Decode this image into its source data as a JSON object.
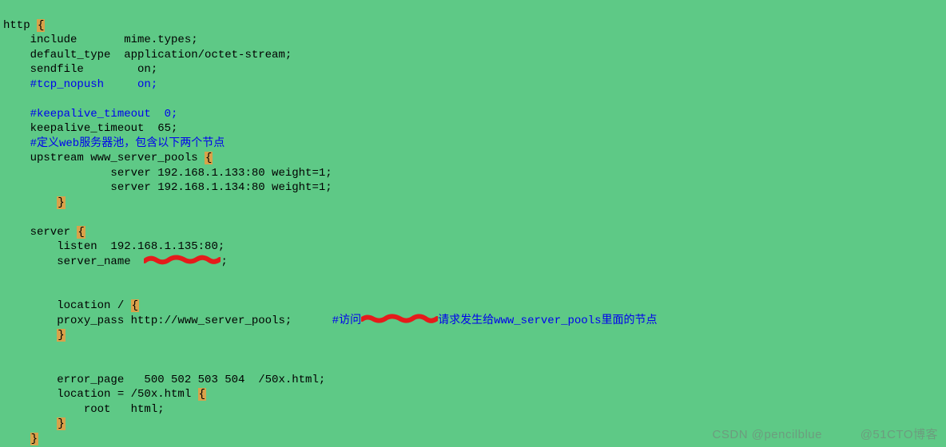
{
  "code": {
    "line1_a": "http ",
    "line1_b": "{",
    "line2": "    include       mime.types;",
    "line3": "    default_type  application/octet-stream;",
    "line4": "    sendfile        on;",
    "line5": "    #tcp_nopush     on;",
    "line6": "",
    "line7": "    #keepalive_timeout  0;",
    "line8": "    keepalive_timeout  65;",
    "line9": "    #定义web服务器池，包含以下两个节点",
    "line10_a": "    upstream www_server_pools ",
    "line10_b": "{",
    "line11": "                server 192.168.1.133:80 weight=1;",
    "line12": "                server 192.168.1.134:80 weight=1;",
    "line13_a": "        ",
    "line13_b": "}",
    "line14": "",
    "line15_a": "    server ",
    "line15_b": "{",
    "line16": "        listen  192.168.1.135:80;",
    "line17_a": "        server_name  ",
    "line17_b": ";",
    "line18": "",
    "line19": "",
    "line20_a": "        location / ",
    "line20_b": "{",
    "line21_a": "        proxy_pass http://www_server_pools;      ",
    "line21_b": "#访问",
    "line21_c": "请求发生给www_server_pools里面的节点",
    "line22_a": "        ",
    "line22_b": "}",
    "line23": "",
    "line24": "",
    "line25": "        error_page   500 502 503 504  /50x.html;",
    "line26_a": "        location = /50x.html ",
    "line26_b": "{",
    "line27": "            root   html;",
    "line28_a": "        ",
    "line28_b": "}",
    "line29_a": "    ",
    "line29_b": "}"
  },
  "watermarks": {
    "left": "CSDN @pencilblue",
    "right": "@51CTO博客"
  }
}
